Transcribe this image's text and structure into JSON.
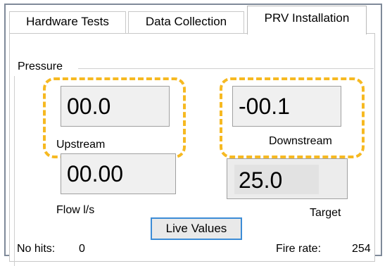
{
  "tabs": {
    "hardware_tests": "Hardware Tests",
    "data_collection": "Data Collection",
    "prv_installation": "PRV Installation",
    "active": "PRV Installation"
  },
  "pressure_group": {
    "title": "Pressure",
    "upstream": {
      "value": "00.0",
      "label": "Upstream"
    },
    "downstream": {
      "value": "-00.1",
      "label": "Downstream"
    },
    "flow": {
      "value": "00.00",
      "label": "Flow l/s"
    },
    "target": {
      "value": "25.0",
      "label": "Target"
    }
  },
  "live_values_button": "Live Values",
  "status": {
    "no_hits_label": "No hits:",
    "no_hits_value": "0",
    "fire_rate_label": "Fire rate:",
    "fire_rate_value": "254"
  },
  "colors": {
    "highlight": "#f6b921",
    "button_border": "#3c8cd6",
    "frame_border": "#7f8a99"
  }
}
